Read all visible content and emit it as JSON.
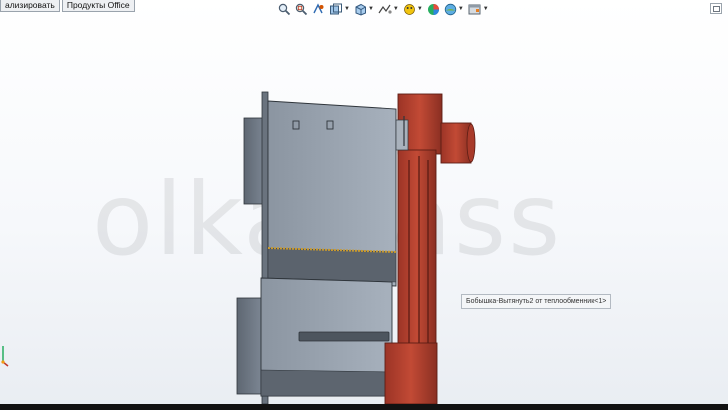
{
  "tabs": [
    {
      "label": "ализировать"
    },
    {
      "label": "Продукты Office"
    }
  ],
  "view_toolbar": {
    "tools": [
      {
        "icon": "zoom-to-fit-icon"
      },
      {
        "icon": "zoom-to-area-icon"
      },
      {
        "icon": "previous-view-icon"
      },
      {
        "icon": "section-view-icon"
      },
      {
        "icon": "view-orientation-icon"
      },
      {
        "icon": "display-style-icon"
      },
      {
        "icon": "hide-show-items-icon"
      },
      {
        "icon": "edit-appearance-icon"
      },
      {
        "icon": "apply-scene-icon"
      },
      {
        "icon": "view-settings-icon"
      }
    ]
  },
  "watermark": {
    "text": "olkatrass"
  },
  "tooltip": {
    "text": "Бобышка-Вытянуть2 от теплообменник<1>"
  },
  "colors": {
    "body": "#7b8592",
    "body_light": "#a2acb8",
    "pipe": "#b3402f",
    "pipe_dark": "#7c2a1f",
    "weld_seam": "#c99a2e"
  }
}
